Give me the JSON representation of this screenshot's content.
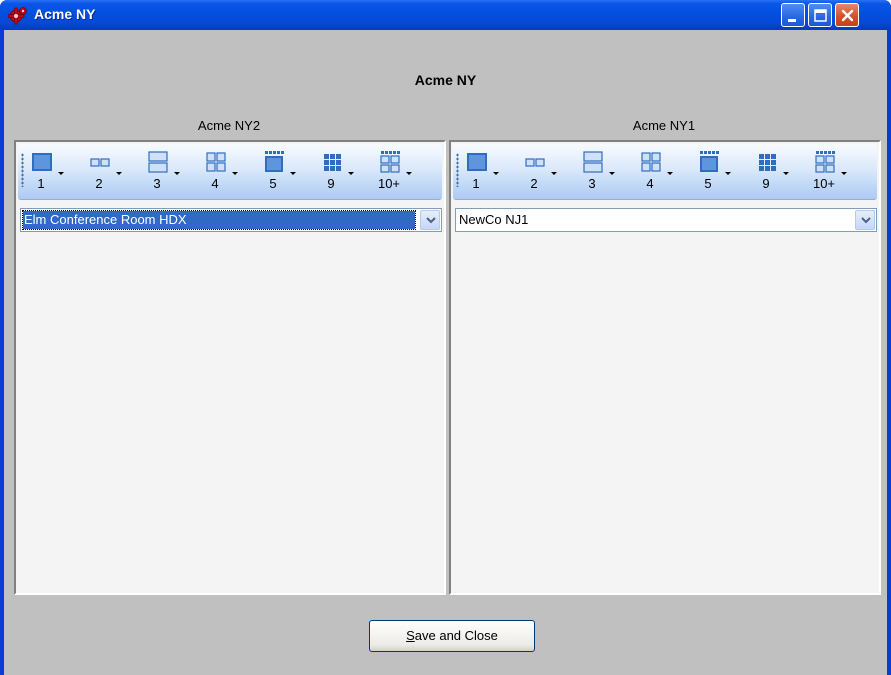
{
  "window": {
    "title": "Acme NY"
  },
  "dialog": {
    "heading": "Acme NY"
  },
  "layout_buttons": [
    "1",
    "2",
    "3",
    "4",
    "5",
    "9",
    "10+"
  ],
  "panels": [
    {
      "label": "Acme NY2",
      "selected_site": "Elm Conference Room HDX",
      "selected": true
    },
    {
      "label": "Acme NY1",
      "selected_site": "NewCo NJ1",
      "selected": false
    }
  ],
  "actions": {
    "save_close": {
      "accel": "S",
      "rest": "ave and Close"
    }
  },
  "icons": {
    "app": "gear-icon",
    "minimize": "minimize-icon",
    "maximize": "maximize-icon",
    "close": "close-icon",
    "dropdown": "chevron-down-icon"
  },
  "colors": {
    "titlebar": "#0a55e8",
    "client_bg": "#c0c0c0",
    "selection": "#316ac5",
    "close_button": "#d6512a"
  }
}
